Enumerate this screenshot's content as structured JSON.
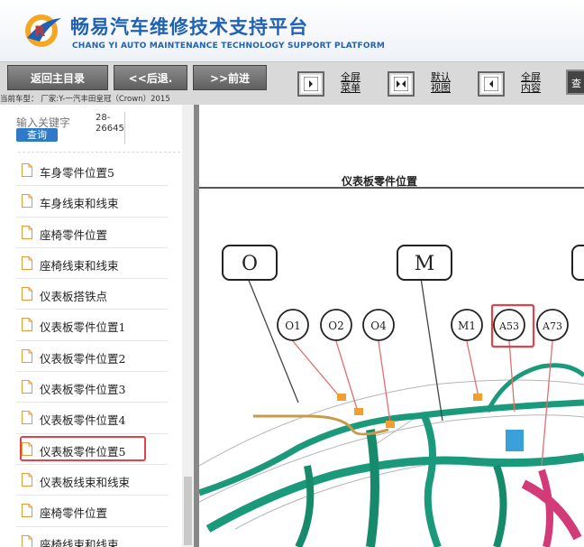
{
  "header": {
    "title_cn": "畅易汽车维修技术支持平台",
    "title_en": "CHANG YI AUTO MAINTENANCE TECHNOLOGY SUPPORT PLATFORM",
    "brand_color": "#1f62b5"
  },
  "toolbar": {
    "back_home": "返回主目录",
    "prev": "<<后退.",
    "next": ">>前进",
    "fullscreen_menu_l1": "全屏",
    "fullscreen_menu_l2": "菜单",
    "default_view_l1": "默认",
    "default_view_l2": "视图",
    "fullscreen_content_l1": "全屏",
    "fullscreen_content_l2": "内容",
    "last_button": "查"
  },
  "vehicle": {
    "info": "当前车型： 厂家:Y-一汽丰田皇冠（Crown）2015"
  },
  "sidebar": {
    "search_placeholder": "输入关键字",
    "search_button": "查询",
    "code_l1": "28-",
    "code_l2": "26645",
    "items": [
      {
        "label": "车身零件位置5"
      },
      {
        "label": "车身线束和线束"
      },
      {
        "label": "座椅零件位置"
      },
      {
        "label": "座椅线束和线束"
      },
      {
        "label": "仪表板搭铁点"
      },
      {
        "label": "仪表板零件位置1"
      },
      {
        "label": "仪表板零件位置2"
      },
      {
        "label": "仪表板零件位置3"
      },
      {
        "label": "仪表板零件位置4"
      },
      {
        "label": "仪表板零件位置5",
        "selected": true
      },
      {
        "label": "仪表板线束和线束"
      },
      {
        "label": "座椅零件位置"
      },
      {
        "label": "座椅线束和线束"
      }
    ],
    "highlight_color": "#e0434b"
  },
  "diagram": {
    "title": "仪表板零件位置",
    "connectors": [
      "O1",
      "O2",
      "O4",
      "M1",
      "A53",
      "A73"
    ],
    "highlighted_connector": "A53",
    "group_boxes": [
      "O",
      "M"
    ],
    "harness_color": "#1a9a7a",
    "wire_color": "#e07070"
  }
}
